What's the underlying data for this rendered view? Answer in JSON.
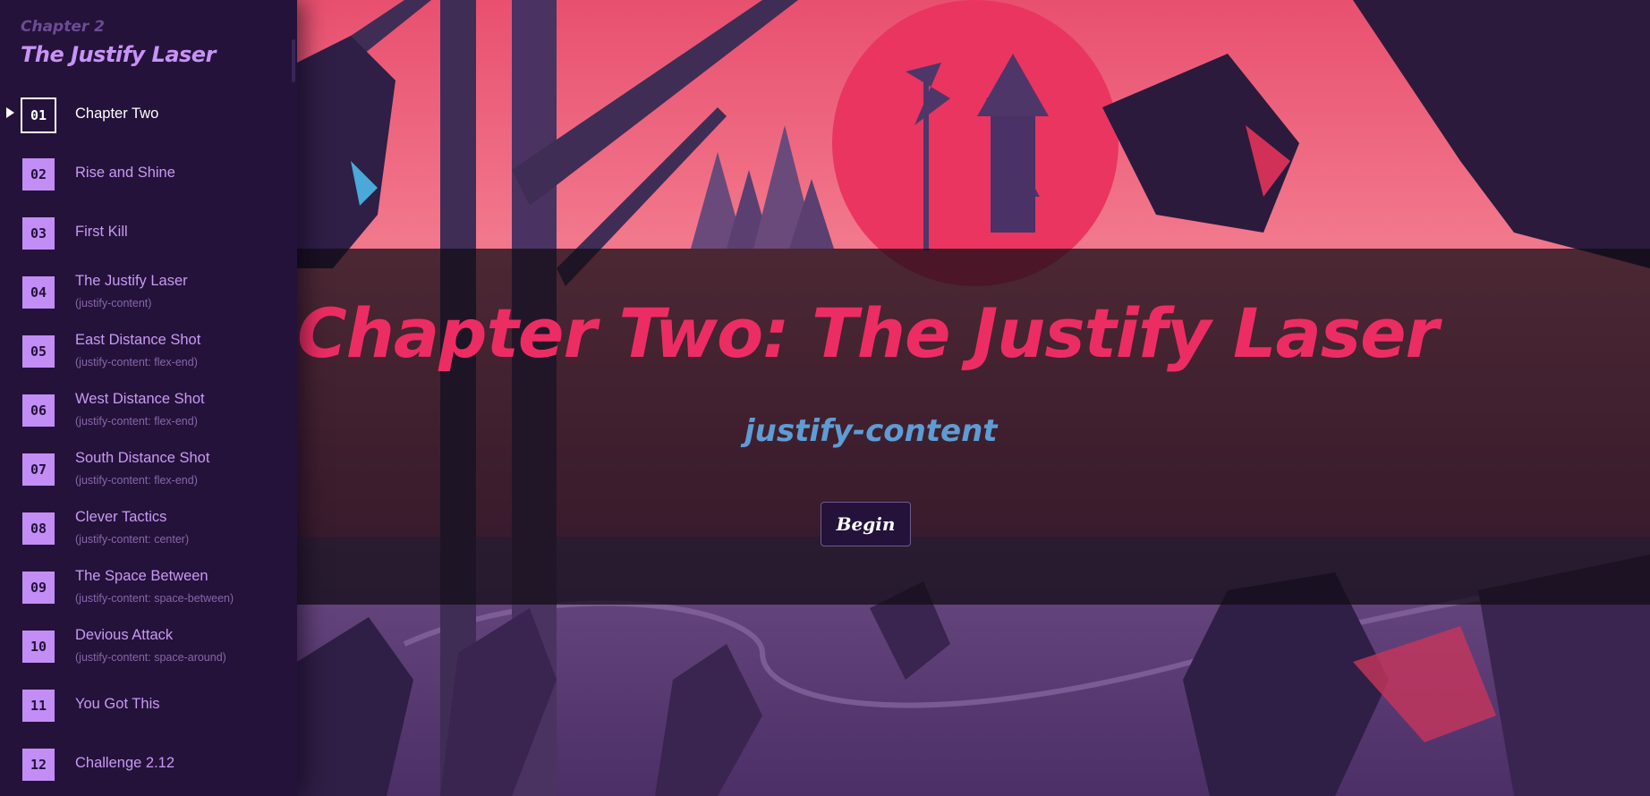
{
  "sidebar": {
    "chapter_label": "Chapter 2",
    "chapter_title": "The Justify Laser",
    "levels": [
      {
        "num": "01",
        "name": "Chapter Two",
        "hint": "",
        "active": true
      },
      {
        "num": "02",
        "name": "Rise and Shine",
        "hint": ""
      },
      {
        "num": "03",
        "name": "First Kill",
        "hint": ""
      },
      {
        "num": "04",
        "name": "The Justify Laser",
        "hint": "(justify-content)"
      },
      {
        "num": "05",
        "name": "East Distance Shot",
        "hint": "(justify-content: flex-end)"
      },
      {
        "num": "06",
        "name": "West Distance Shot",
        "hint": "(justify-content: flex-end)"
      },
      {
        "num": "07",
        "name": "South Distance Shot",
        "hint": "(justify-content: flex-end)"
      },
      {
        "num": "08",
        "name": "Clever Tactics",
        "hint": "(justify-content: center)"
      },
      {
        "num": "09",
        "name": "The Space Between",
        "hint": "(justify-content: space-between)"
      },
      {
        "num": "10",
        "name": "Devious Attack",
        "hint": "(justify-content: space-around)"
      },
      {
        "num": "11",
        "name": "You Got This",
        "hint": ""
      },
      {
        "num": "12",
        "name": "Challenge 2.12",
        "hint": ""
      }
    ]
  },
  "main": {
    "title": "Chapter Two: The Justify Laser",
    "subtitle": "justify-content",
    "begin_label": "Begin"
  },
  "colors": {
    "sidebar_bg": "#24123a",
    "accent_pink": "#ec2d63",
    "accent_blue": "#5e9cd4",
    "level_badge": "#c28ef5"
  }
}
